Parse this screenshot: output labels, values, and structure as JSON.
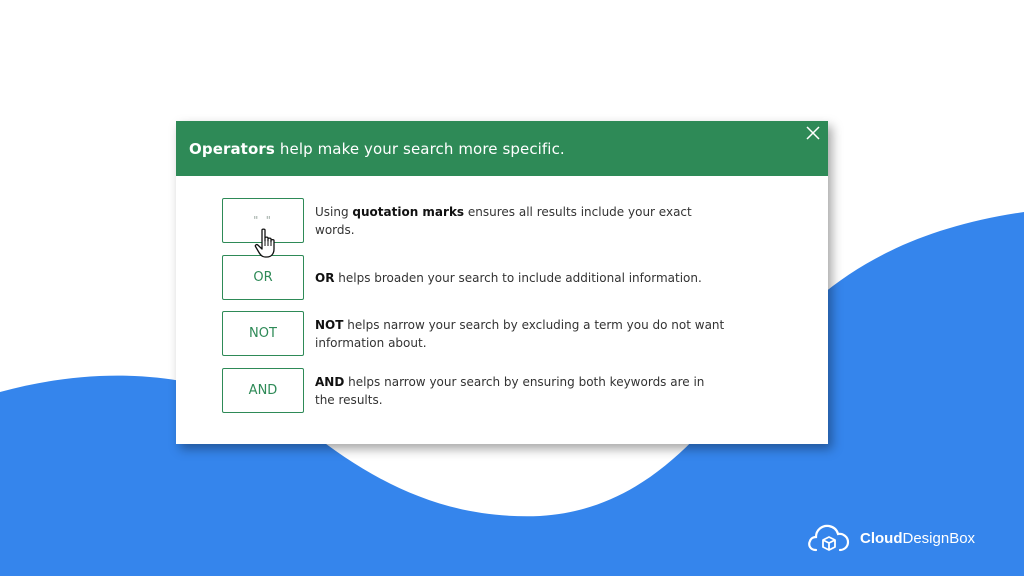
{
  "colors": {
    "accent": "#2e8a57",
    "wave": "#3585ec",
    "text": "#333333"
  },
  "dialog": {
    "header": {
      "bold": "Operators",
      "rest": "help make your search more specific."
    },
    "close_icon": "close-icon",
    "operators": [
      {
        "label": "\" \"",
        "desc_bold": "quotation marks",
        "desc_pre": "Using ",
        "desc_post": " ensures all results include your exact words."
      },
      {
        "label": "OR",
        "desc_bold": "OR",
        "desc_pre": "",
        "desc_post": " helps broaden your search to include additional information."
      },
      {
        "label": "NOT",
        "desc_bold": "NOT",
        "desc_pre": "",
        "desc_post": " helps narrow your search by excluding a term you do not want information about."
      },
      {
        "label": "AND",
        "desc_bold": "AND",
        "desc_pre": "",
        "desc_post": " helps narrow your search by ensuring both keywords are in the results."
      }
    ]
  },
  "branding": {
    "bold": "Cloud",
    "rest": "DesignBox",
    "icon": "cloud-box-icon"
  }
}
